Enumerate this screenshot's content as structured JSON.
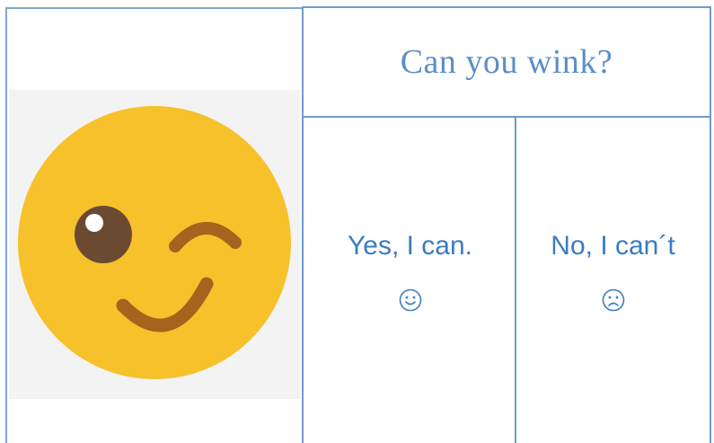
{
  "title": "Can you wink?",
  "options": [
    {
      "label": "Yes, I can.",
      "icon": "smiley-face-icon"
    },
    {
      "label": "No, I can´t",
      "icon": "frowning-face-icon"
    }
  ],
  "colors": {
    "border": "#6f9bcc",
    "title_text": "#5b8fc6",
    "answer_text": "#3a7cc2",
    "emoji_face": "#f7c12c",
    "emoji_features": "#6b4a32"
  }
}
